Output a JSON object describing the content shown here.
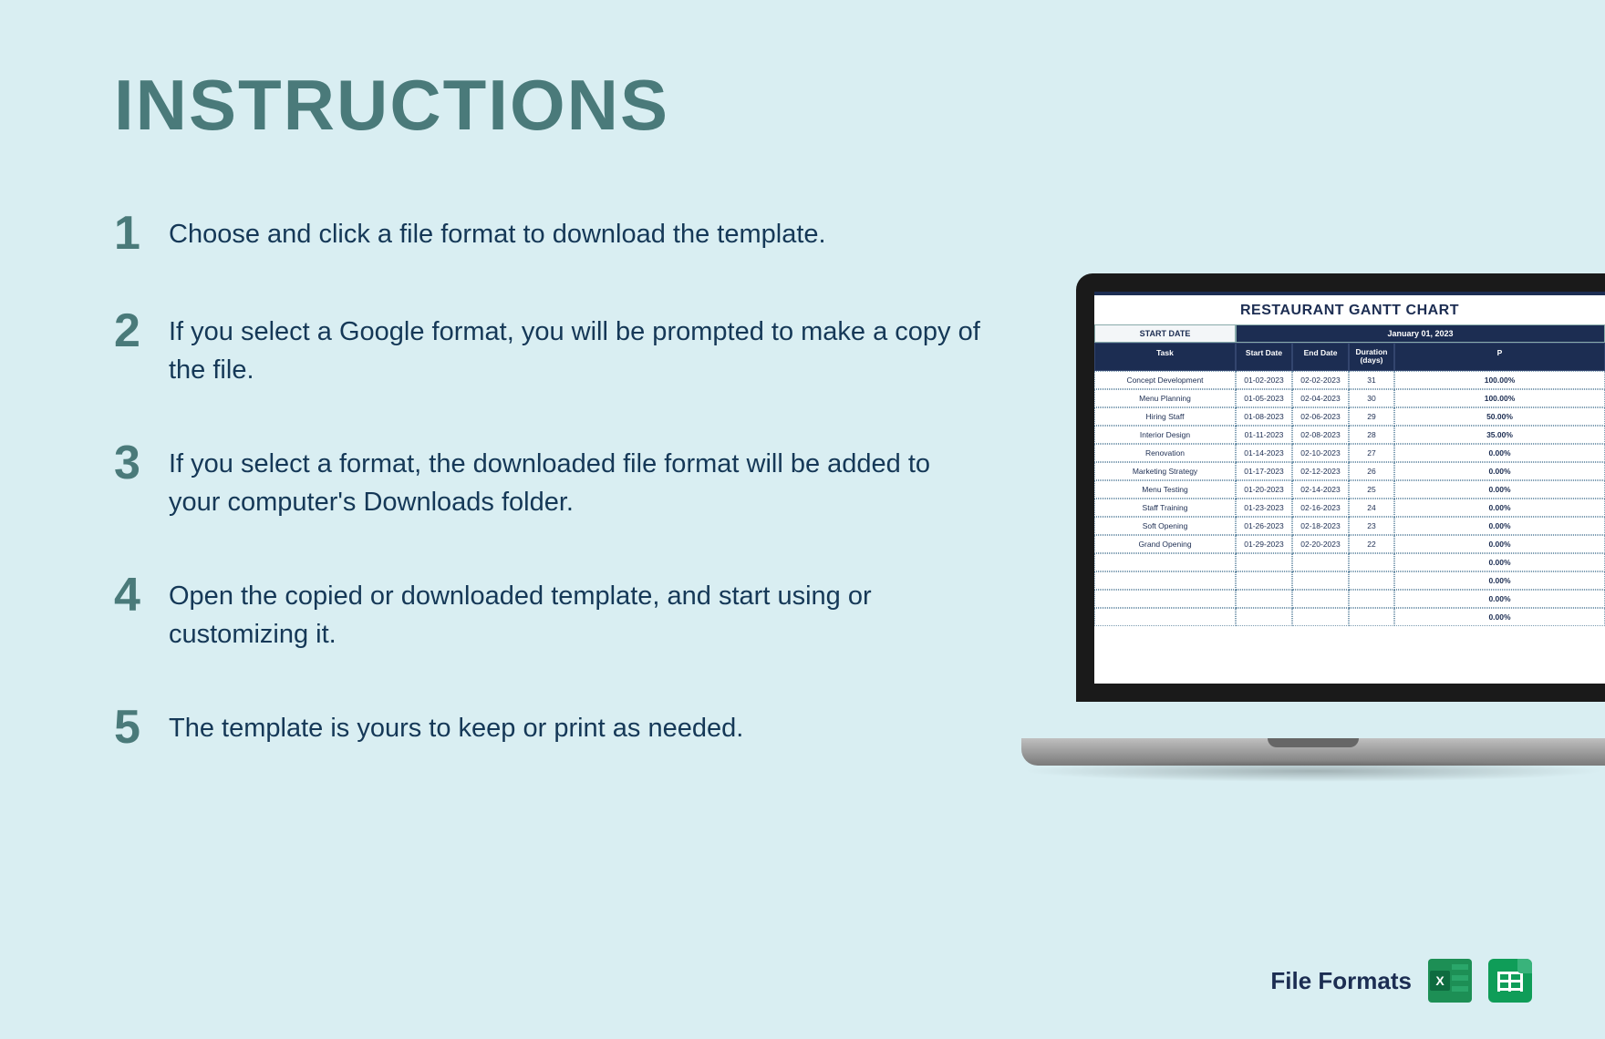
{
  "heading": "INSTRUCTIONS",
  "steps": [
    {
      "num": "1",
      "text": "Choose and click a file format to download the template."
    },
    {
      "num": "2",
      "text": "If you select a Google format, you will be prompted to make a copy of the file."
    },
    {
      "num": "3",
      "text": "If you select a format, the downloaded file format will be added to your computer's Downloads folder."
    },
    {
      "num": "4",
      "text": "Open the copied or downloaded template, and start using or customizing it."
    },
    {
      "num": "5",
      "text": "The template is yours to keep or print as needed."
    }
  ],
  "laptop": {
    "sheet_title": "RESTAURANT GANTT CHART",
    "start_label": "START DATE",
    "date_label": "January 01, 2023",
    "columns": {
      "task": "Task",
      "start": "Start Date",
      "end": "End Date",
      "duration": "Duration (days)",
      "pct": "P"
    },
    "rows": [
      {
        "task": "Concept Development",
        "start": "01-02-2023",
        "end": "02-02-2023",
        "dur": "31",
        "pct": "100.00%"
      },
      {
        "task": "Menu Planning",
        "start": "01-05-2023",
        "end": "02-04-2023",
        "dur": "30",
        "pct": "100.00%"
      },
      {
        "task": "Hiring Staff",
        "start": "01-08-2023",
        "end": "02-06-2023",
        "dur": "29",
        "pct": "50.00%"
      },
      {
        "task": "Interior Design",
        "start": "01-11-2023",
        "end": "02-08-2023",
        "dur": "28",
        "pct": "35.00%"
      },
      {
        "task": "Renovation",
        "start": "01-14-2023",
        "end": "02-10-2023",
        "dur": "27",
        "pct": "0.00%"
      },
      {
        "task": "Marketing Strategy",
        "start": "01-17-2023",
        "end": "02-12-2023",
        "dur": "26",
        "pct": "0.00%"
      },
      {
        "task": "Menu Testing",
        "start": "01-20-2023",
        "end": "02-14-2023",
        "dur": "25",
        "pct": "0.00%"
      },
      {
        "task": "Staff Training",
        "start": "01-23-2023",
        "end": "02-16-2023",
        "dur": "24",
        "pct": "0.00%"
      },
      {
        "task": "Soft Opening",
        "start": "01-26-2023",
        "end": "02-18-2023",
        "dur": "23",
        "pct": "0.00%"
      },
      {
        "task": "Grand Opening",
        "start": "01-29-2023",
        "end": "02-20-2023",
        "dur": "22",
        "pct": "0.00%"
      },
      {
        "task": "",
        "start": "",
        "end": "",
        "dur": "",
        "pct": "0.00%"
      },
      {
        "task": "",
        "start": "",
        "end": "",
        "dur": "",
        "pct": "0.00%"
      },
      {
        "task": "",
        "start": "",
        "end": "",
        "dur": "",
        "pct": "0.00%"
      },
      {
        "task": "",
        "start": "",
        "end": "",
        "dur": "",
        "pct": "0.00%"
      }
    ]
  },
  "file_formats_label": "File Formats",
  "icons": {
    "excel": "excel-icon",
    "sheets": "google-sheets-icon"
  }
}
